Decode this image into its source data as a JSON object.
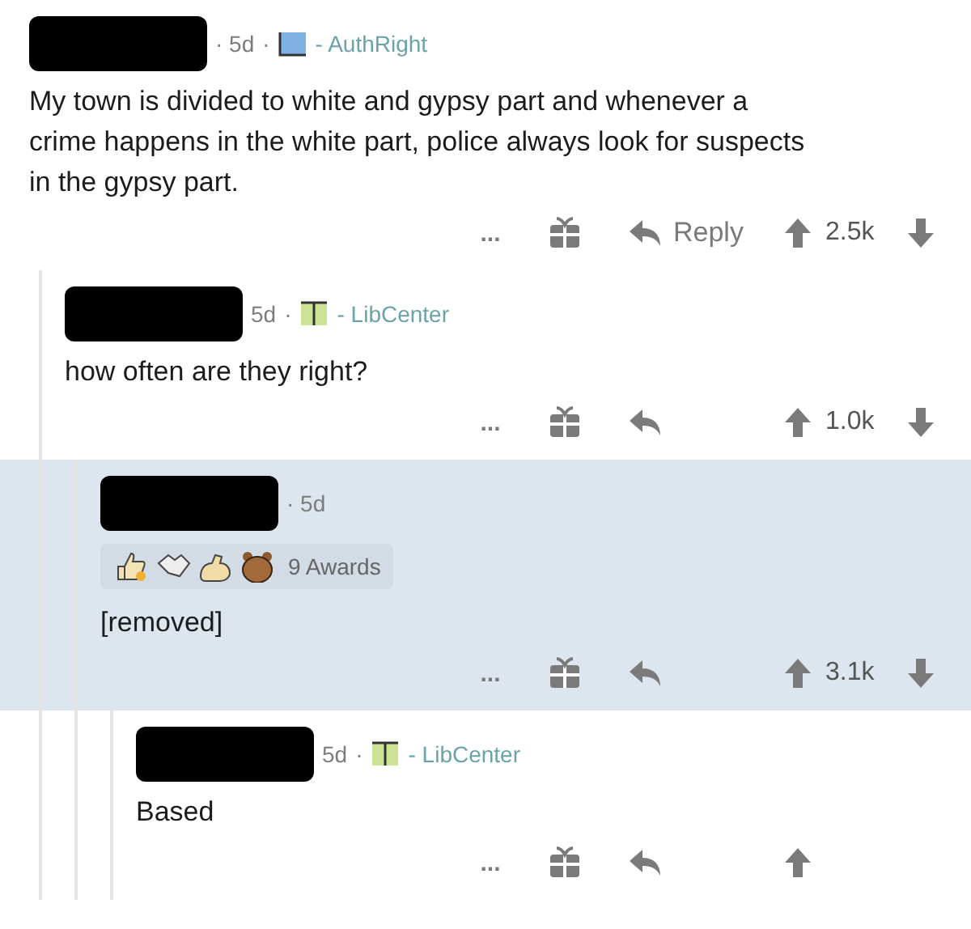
{
  "comments": [
    {
      "age": "· 5d",
      "flair": {
        "kind": "authright",
        "separator": "·",
        "text": "- AuthRight"
      },
      "highlighted": false,
      "body": "My town is divided to white and gypsy part and whenever a crime happens in the white part, police always look for suspects in the gypsy part.",
      "actions": {
        "more": "...",
        "reply": "Reply",
        "score": "2.5k"
      },
      "children": [
        {
          "age": "5d",
          "flair": {
            "kind": "libcenter",
            "separator": "·",
            "text": "- LibCenter"
          },
          "highlighted": false,
          "body": "how often are they right?",
          "actions": {
            "more": "...",
            "score": "1.0k"
          },
          "children": [
            {
              "age": "· 5d",
              "highlighted": true,
              "awards": "9 Awards",
              "body": "[removed]",
              "actions": {
                "more": "...",
                "score": "3.1k"
              },
              "children": [
                {
                  "age": "5d",
                  "flair": {
                    "kind": "libcenter",
                    "separator": "·",
                    "text": "- LibCenter"
                  },
                  "highlighted": false,
                  "body": "Based",
                  "actions": {
                    "more": "..."
                  }
                }
              ]
            }
          ]
        }
      ]
    }
  ]
}
